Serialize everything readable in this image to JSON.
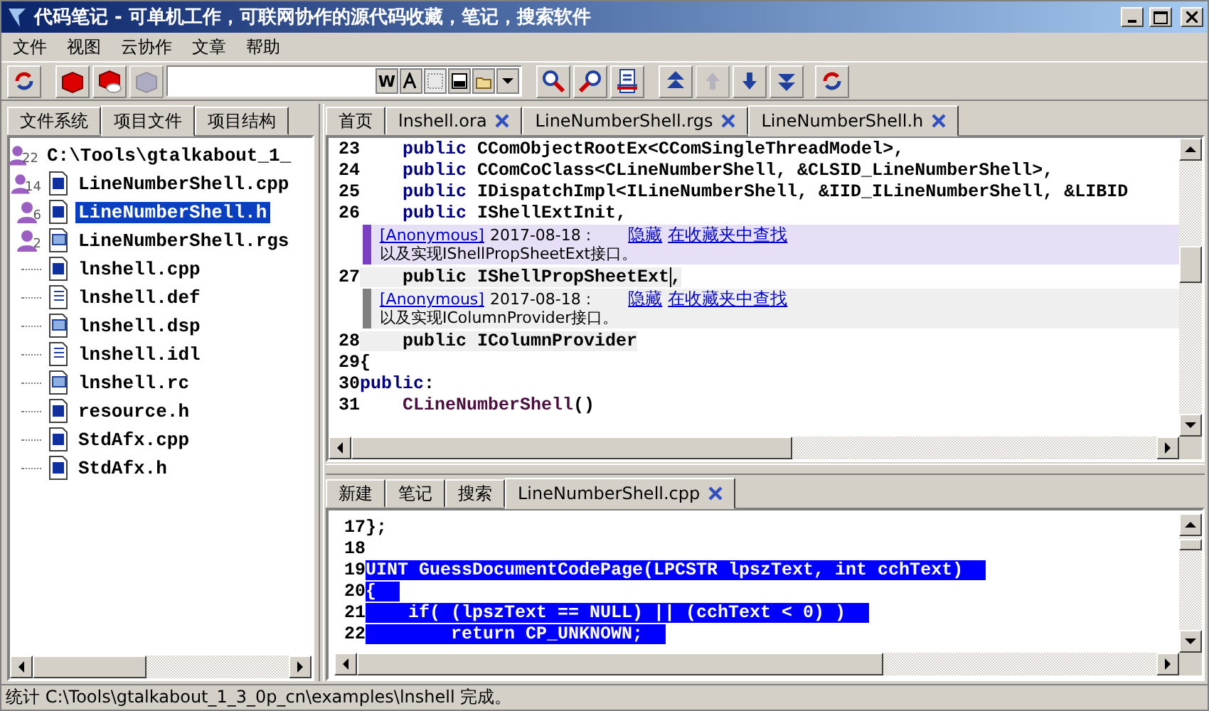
{
  "window": {
    "title": "代码笔记 - 可单机工作，可联网协作的源代码收藏，笔记，搜索软件"
  },
  "menu": [
    "文件",
    "视图",
    "云协作",
    "文章",
    "帮助"
  ],
  "toolbar_left": [
    {
      "kind": "sync",
      "disabled": false
    },
    {
      "kind": "cube",
      "disabled": false
    },
    {
      "kind": "cube-cloud",
      "disabled": false
    },
    {
      "kind": "cube",
      "disabled": true
    }
  ],
  "search": {
    "option_label": "W"
  },
  "toolbar_right": [
    {
      "kind": "find-prev",
      "disabled": false
    },
    {
      "kind": "find-next",
      "disabled": false
    },
    {
      "kind": "print",
      "disabled": false
    },
    {
      "kind": "first",
      "disabled": false
    },
    {
      "kind": "up",
      "disabled": true
    },
    {
      "kind": "down",
      "disabled": false
    },
    {
      "kind": "last",
      "disabled": false
    },
    {
      "kind": "sync",
      "disabled": false
    }
  ],
  "left_tabs": [
    {
      "label": "文件系统",
      "selected": false
    },
    {
      "label": "项目文件",
      "selected": true
    },
    {
      "label": "项目结构",
      "selected": false
    }
  ],
  "tree": {
    "label": "C:\\Tools\\gtalkabout_1_",
    "notes": "22",
    "selected": false,
    "children": [
      {
        "label": "LineNumberShell.cpp",
        "kind": "cpp",
        "notes": "14",
        "selected": false
      },
      {
        "label": "LineNumberShell.h",
        "kind": "h",
        "notes": "6",
        "selected": true
      },
      {
        "label": "LineNumberShell.rgs",
        "kind": "rgs",
        "notes": "2",
        "selected": false
      },
      {
        "label": "lnshell.cpp",
        "kind": "cpp",
        "selected": false
      },
      {
        "label": "lnshell.def",
        "kind": "def",
        "selected": false
      },
      {
        "label": "lnshell.dsp",
        "kind": "dsp",
        "selected": false
      },
      {
        "label": "lnshell.idl",
        "kind": "idl",
        "selected": false
      },
      {
        "label": "lnshell.rc",
        "kind": "rc",
        "selected": false
      },
      {
        "label": "resource.h",
        "kind": "h",
        "selected": false
      },
      {
        "label": "StdAfx.cpp",
        "kind": "cpp",
        "selected": false
      },
      {
        "label": "StdAfx.h",
        "kind": "h",
        "selected": false
      }
    ]
  },
  "editor_tabs": [
    {
      "label": "首页",
      "closable": false,
      "selected": false
    },
    {
      "label": "lnshell.ora",
      "closable": true,
      "selected": false
    },
    {
      "label": "LineNumberShell.rgs",
      "closable": true,
      "selected": false
    },
    {
      "label": "LineNumberShell.h",
      "closable": true,
      "selected": true
    }
  ],
  "editor_lines": [
    {
      "kind": "code",
      "number": "23",
      "indented": true,
      "highlighted": false,
      "parts": [
        {
          "kind": "keyword",
          "text": "public"
        },
        {
          "kind": "plain",
          "text": " CComObjectRootEx<CComSingleThreadModel>,"
        }
      ]
    },
    {
      "kind": "code",
      "number": "24",
      "indented": true,
      "highlighted": false,
      "parts": [
        {
          "kind": "keyword",
          "text": "public"
        },
        {
          "kind": "plain",
          "text": " CComCoClass<CLineNumberShell, &CLSID_LineNumberShell>,"
        }
      ]
    },
    {
      "kind": "code",
      "number": "25",
      "indented": true,
      "highlighted": false,
      "parts": [
        {
          "kind": "keyword",
          "text": "public"
        },
        {
          "kind": "plain",
          "text": " IDispatchImpl<ILineNumberShell, &IID_ILineNumberShell, &LIBID"
        }
      ]
    },
    {
      "kind": "code",
      "number": "26",
      "indented": true,
      "highlighted": false,
      "parts": [
        {
          "kind": "keyword",
          "text": "public"
        },
        {
          "kind": "plain",
          "text": " IShellExtInit,"
        }
      ]
    },
    {
      "kind": "note",
      "selected": true,
      "author": "[Anonymous]",
      "date": "2017-08-18 :",
      "links": [
        "隐藏",
        "在收藏夹中查找"
      ],
      "text": "以及实现IShellPropSheetExt接口。"
    },
    {
      "kind": "code",
      "number": "27",
      "indented": true,
      "highlighted": true,
      "parts": [
        {
          "kind": "plain",
          "text": "public IShellPropSheetExt"
        },
        {
          "kind": "caret",
          "text": ","
        }
      ]
    },
    {
      "kind": "note",
      "selected": false,
      "author": "[Anonymous]",
      "date": "2017-08-18 :",
      "links": [
        "隐藏",
        "在收藏夹中查找"
      ],
      "text": "以及实现IColumnProvider接口。"
    },
    {
      "kind": "code",
      "number": "28",
      "indented": true,
      "highlighted": true,
      "parts": [
        {
          "kind": "plain",
          "text": "public IColumnProvider"
        }
      ]
    },
    {
      "kind": "code",
      "number": "29",
      "highlighted": false,
      "parts": [
        {
          "kind": "plain",
          "text": "{"
        }
      ]
    },
    {
      "kind": "code",
      "number": "30",
      "highlighted": false,
      "parts": [
        {
          "kind": "keyword",
          "text": "public"
        },
        {
          "kind": "plain",
          "text": ":"
        }
      ]
    },
    {
      "kind": "code",
      "number": "31",
      "indented": true,
      "highlighted": false,
      "parts": [
        {
          "kind": "function",
          "text": "CLineNumberShell"
        },
        {
          "kind": "plain",
          "text": "()"
        }
      ]
    }
  ],
  "bottom_tabs": [
    {
      "label": "新建",
      "closable": false,
      "selected": false
    },
    {
      "label": "笔记",
      "closable": false,
      "selected": false
    },
    {
      "label": "搜索",
      "closable": false,
      "selected": false
    },
    {
      "label": "LineNumberShell.cpp",
      "closable": true,
      "selected": true
    }
  ],
  "bottom_lines": [
    {
      "number": "17",
      "text": "};",
      "selected": false
    },
    {
      "number": "18",
      "selected": false
    },
    {
      "number": "19",
      "text": "UINT GuessDocumentCodePage(LPCSTR lpszText, int cchText)",
      "selected": true
    },
    {
      "number": "20",
      "text": "{",
      "selected": true
    },
    {
      "number": "21",
      "text": "    if( (lpszText == NULL) || (cchText < 0) )",
      "selected": true
    },
    {
      "number": "22",
      "text": "        return CP_UNKNOWN;",
      "selected": true
    }
  ],
  "status_bar": "统计 C:\\Tools\\gtalkabout_1_3_0p_cn\\examples\\lnshell 完成。"
}
